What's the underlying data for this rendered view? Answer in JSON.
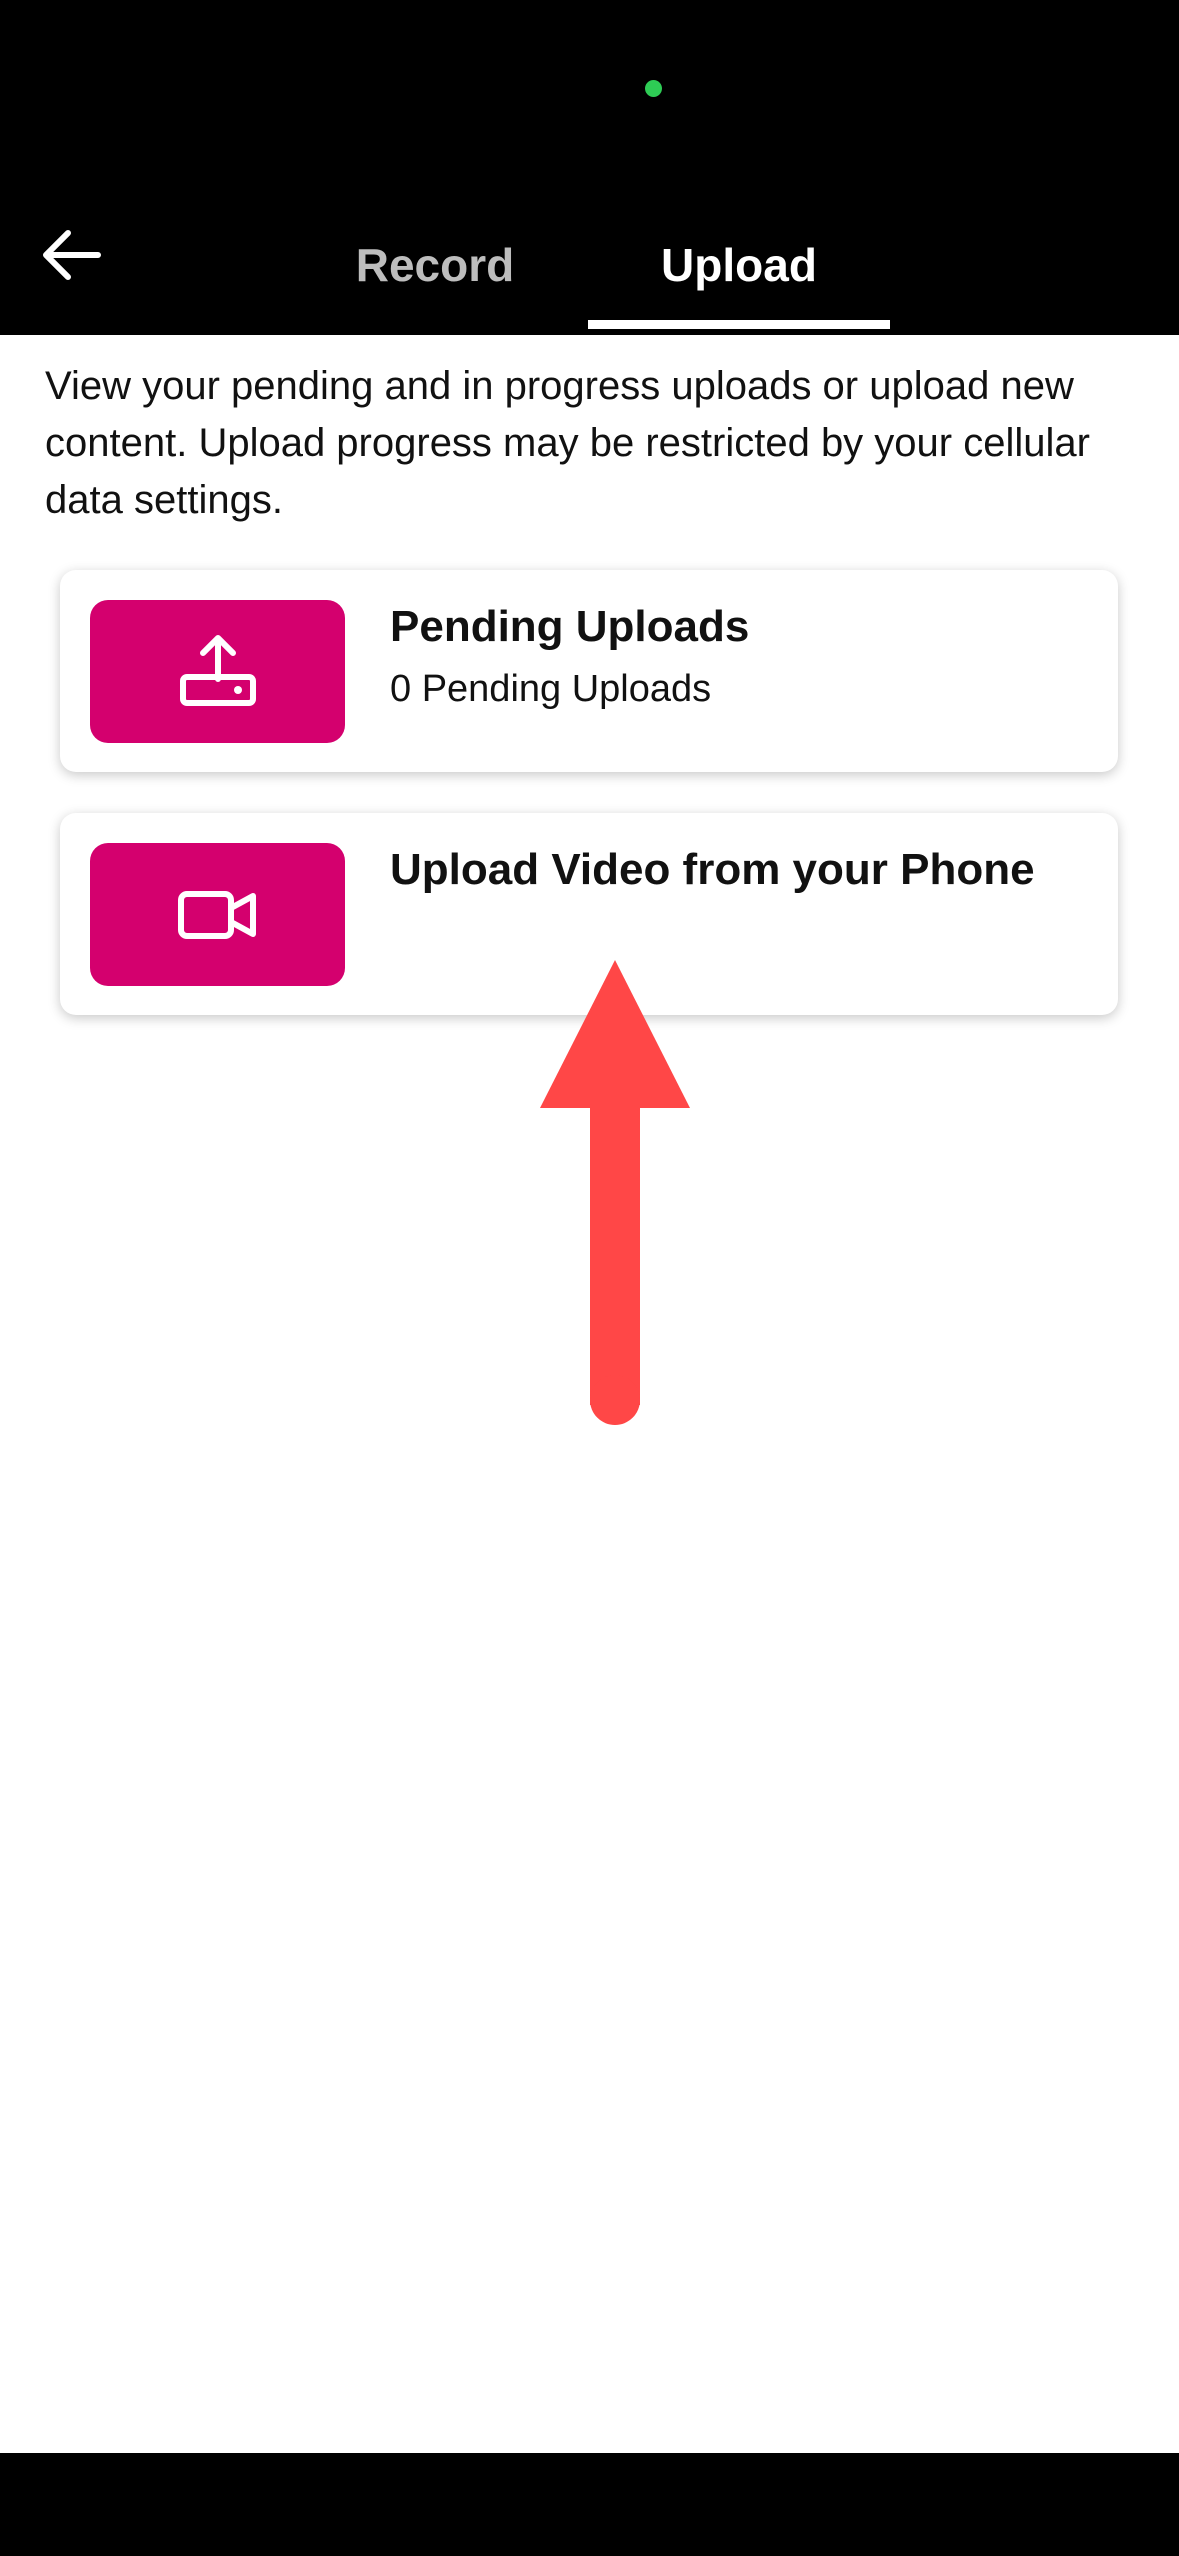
{
  "header": {
    "back_icon": "arrow-left-icon",
    "tabs": [
      {
        "label": "Record",
        "active": false
      },
      {
        "label": "Upload",
        "active": true
      }
    ]
  },
  "main": {
    "description": "View your pending and in progress uploads or upload new content. Upload progress may be restricted by your cellular data settings.",
    "cards": [
      {
        "icon": "upload-tray-icon",
        "title": "Pending Uploads",
        "subtitle": "0 Pending Uploads"
      },
      {
        "icon": "video-camera-icon",
        "title": "Upload Video from your Phone",
        "subtitle": ""
      }
    ]
  },
  "colors": {
    "accent": "#d4006e",
    "header_bg": "#000000",
    "annotation": "#ff4747",
    "camera_indicator": "#2ecc55"
  }
}
